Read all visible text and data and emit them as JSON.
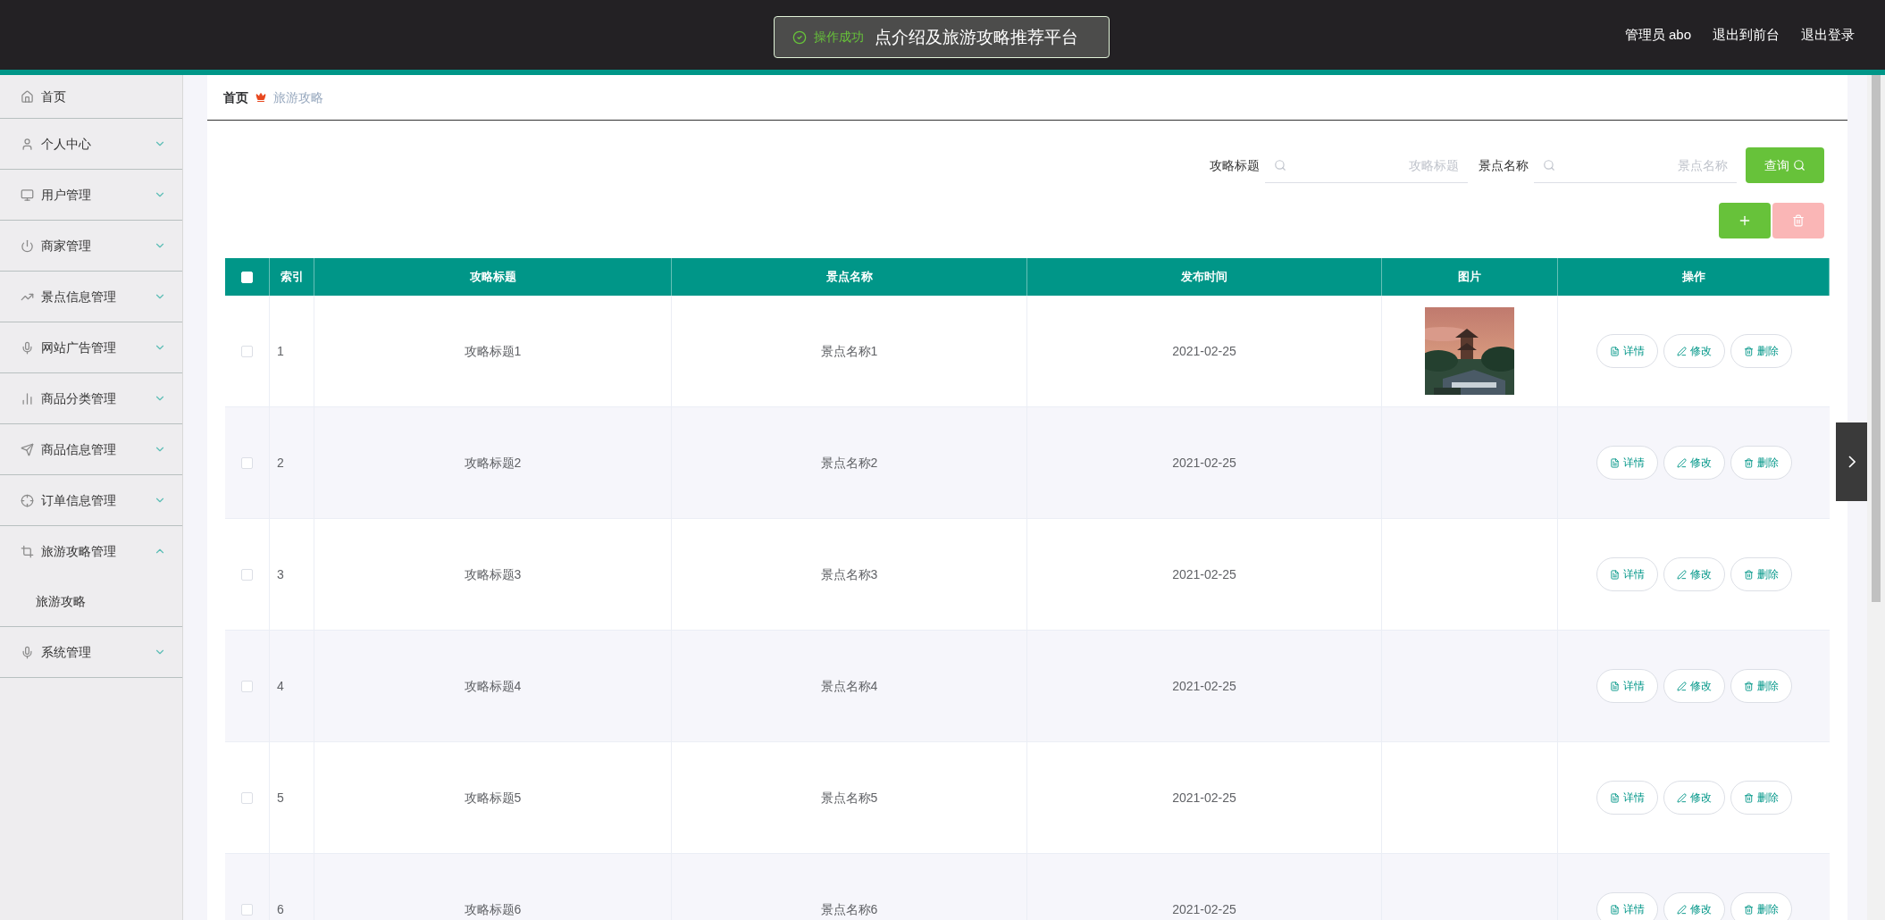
{
  "header": {
    "title": "点介绍及旅游攻略推荐平台",
    "links": [
      "管理员 abo",
      "退出到前台",
      "退出登录"
    ]
  },
  "toast": {
    "kind": "success",
    "message": "操作成功"
  },
  "sidebar": {
    "items": [
      {
        "label": "首页"
      },
      {
        "label": "个人中心",
        "expanded": false
      },
      {
        "label": "用户管理",
        "expanded": false
      },
      {
        "label": "商家管理",
        "expanded": false
      },
      {
        "label": "景点信息管理",
        "expanded": false
      },
      {
        "label": "网站广告管理",
        "expanded": false
      },
      {
        "label": "商品分类管理",
        "expanded": false
      },
      {
        "label": "商品信息管理",
        "expanded": false
      },
      {
        "label": "订单信息管理",
        "expanded": false
      },
      {
        "label": "旅游攻略管理",
        "expanded": true,
        "children": [
          {
            "label": "旅游攻略"
          }
        ]
      },
      {
        "label": "系统管理",
        "expanded": false
      }
    ]
  },
  "breadcrumb": [
    "首页",
    "旅游攻略"
  ],
  "search": {
    "fields": [
      {
        "label": "攻略标题",
        "placeholder": "攻略标题"
      },
      {
        "label": "景点名称",
        "placeholder": "景点名称"
      }
    ],
    "button": "查询"
  },
  "toolbar": [
    {
      "kind": "add",
      "disabled": false
    },
    {
      "kind": "delete",
      "disabled": true
    }
  ],
  "table": {
    "header_checked": false,
    "columns": [
      "索引",
      "攻略标题",
      "景点名称",
      "发布时间",
      "图片",
      "操作"
    ],
    "rows": [
      {
        "checked": false,
        "index": "1",
        "title": "攻略标题1",
        "spot": "景点名称1",
        "date": "2021-02-25",
        "actions": [
          "详情",
          "修改",
          "删除"
        ]
      },
      {
        "checked": false,
        "index": "2",
        "title": "攻略标题2",
        "spot": "景点名称2",
        "date": "2021-02-25",
        "actions": [
          "详情",
          "修改",
          "删除"
        ]
      },
      {
        "checked": false,
        "index": "3",
        "title": "攻略标题3",
        "spot": "景点名称3",
        "date": "2021-02-25",
        "actions": [
          "详情",
          "修改",
          "删除"
        ]
      },
      {
        "checked": false,
        "index": "4",
        "title": "攻略标题4",
        "spot": "景点名称4",
        "date": "2021-02-25",
        "actions": [
          "详情",
          "修改",
          "删除"
        ]
      },
      {
        "checked": false,
        "index": "5",
        "title": "攻略标题5",
        "spot": "景点名称5",
        "date": "2021-02-25",
        "actions": [
          "详情",
          "修改",
          "删除"
        ]
      },
      {
        "checked": false,
        "index": "6",
        "title": "攻略标题6",
        "spot": "景点名称6",
        "date": "2021-02-25",
        "actions": [
          "详情",
          "修改",
          "删除"
        ]
      }
    ]
  }
}
